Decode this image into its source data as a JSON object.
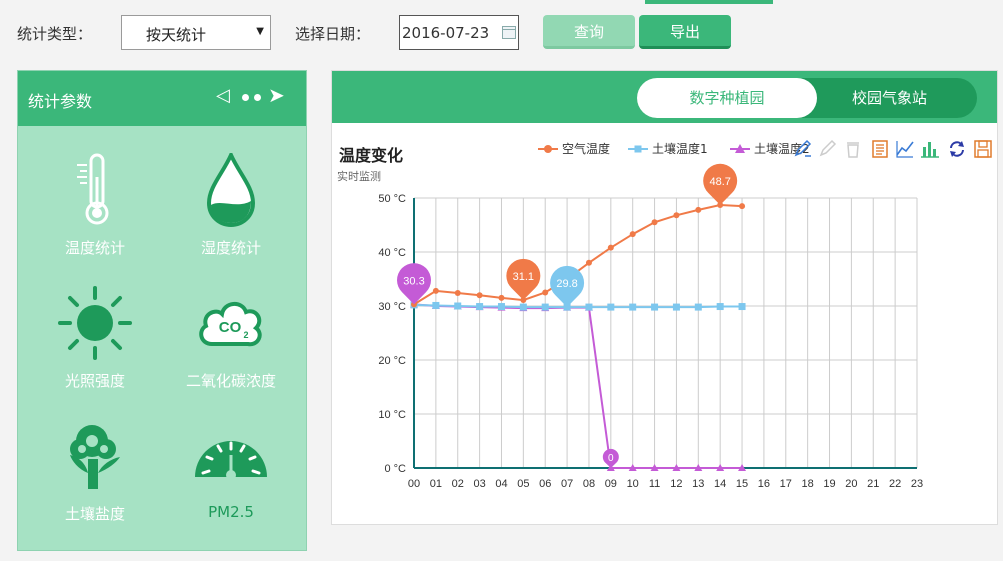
{
  "toolbar": {
    "type_label": "统计类型：",
    "type_value": "按天统计",
    "date_label": "选择日期：",
    "date_value": "2016-07-23",
    "query_label": "查询",
    "export_label": "导出"
  },
  "left": {
    "title": "统计参数",
    "params": [
      {
        "label": "温度统计",
        "icon": "thermometer-icon"
      },
      {
        "label": "湿度统计",
        "icon": "water-drop-icon"
      },
      {
        "label": "光照强度",
        "icon": "sun-icon"
      },
      {
        "label": "二氧化碳浓度",
        "icon": "co2-cloud-icon"
      },
      {
        "label": "土壤盐度",
        "icon": "plant-icon"
      },
      {
        "label": "PM2.5",
        "icon": "gauge-icon"
      }
    ]
  },
  "tabs": {
    "tab1": "数字种植园",
    "tab2": "校园气象站"
  },
  "chart": {
    "title": "温度变化",
    "subtitle": "实时监测"
  },
  "colors": {
    "primary": "#3bb77a",
    "air": "#f07a48",
    "soil1": "#7dc7ee",
    "soil2": "#c45bd6"
  },
  "chart_data": {
    "type": "line",
    "x": [
      "00",
      "01",
      "02",
      "03",
      "04",
      "05",
      "06",
      "07",
      "08",
      "09",
      "10",
      "11",
      "12",
      "13",
      "14",
      "15",
      "16",
      "17",
      "18",
      "19",
      "20",
      "21",
      "22",
      "23"
    ],
    "yticks": [
      "0 °C",
      "10 °C",
      "20 °C",
      "30 °C",
      "40 °C",
      "50 °C"
    ],
    "ylim": [
      0,
      50
    ],
    "grid": true,
    "legend_position": "top-right",
    "series": [
      {
        "name": "空气温度",
        "color": "#f07a48",
        "marker": "circle",
        "values": [
          30.3,
          32.8,
          32.4,
          32.0,
          31.5,
          31.1,
          32.5,
          35.0,
          38.0,
          40.8,
          43.3,
          45.5,
          46.8,
          47.8,
          48.7,
          48.5
        ]
      },
      {
        "name": "土壤温度1",
        "color": "#7dc7ee",
        "marker": "square",
        "values": [
          30.2,
          30.1,
          30.0,
          29.9,
          29.9,
          29.8,
          29.8,
          29.8,
          29.8,
          29.8,
          29.8,
          29.8,
          29.8,
          29.8,
          29.9,
          29.9
        ]
      },
      {
        "name": "土壤温度2",
        "color": "#c45bd6",
        "marker": "triangle",
        "values": [
          30.3,
          30.0,
          29.9,
          29.8,
          29.7,
          29.6,
          29.6,
          29.7,
          29.7,
          0,
          0,
          0,
          0,
          0,
          0,
          0
        ]
      }
    ],
    "markers": [
      {
        "series": 2,
        "index": 0,
        "value": "30.3"
      },
      {
        "series": 0,
        "index": 5,
        "value": "31.1"
      },
      {
        "series": 1,
        "index": 7,
        "value": "29.8"
      },
      {
        "series": 0,
        "index": 14,
        "value": "48.7"
      },
      {
        "series": 2,
        "index": 9,
        "value": "0"
      }
    ]
  }
}
